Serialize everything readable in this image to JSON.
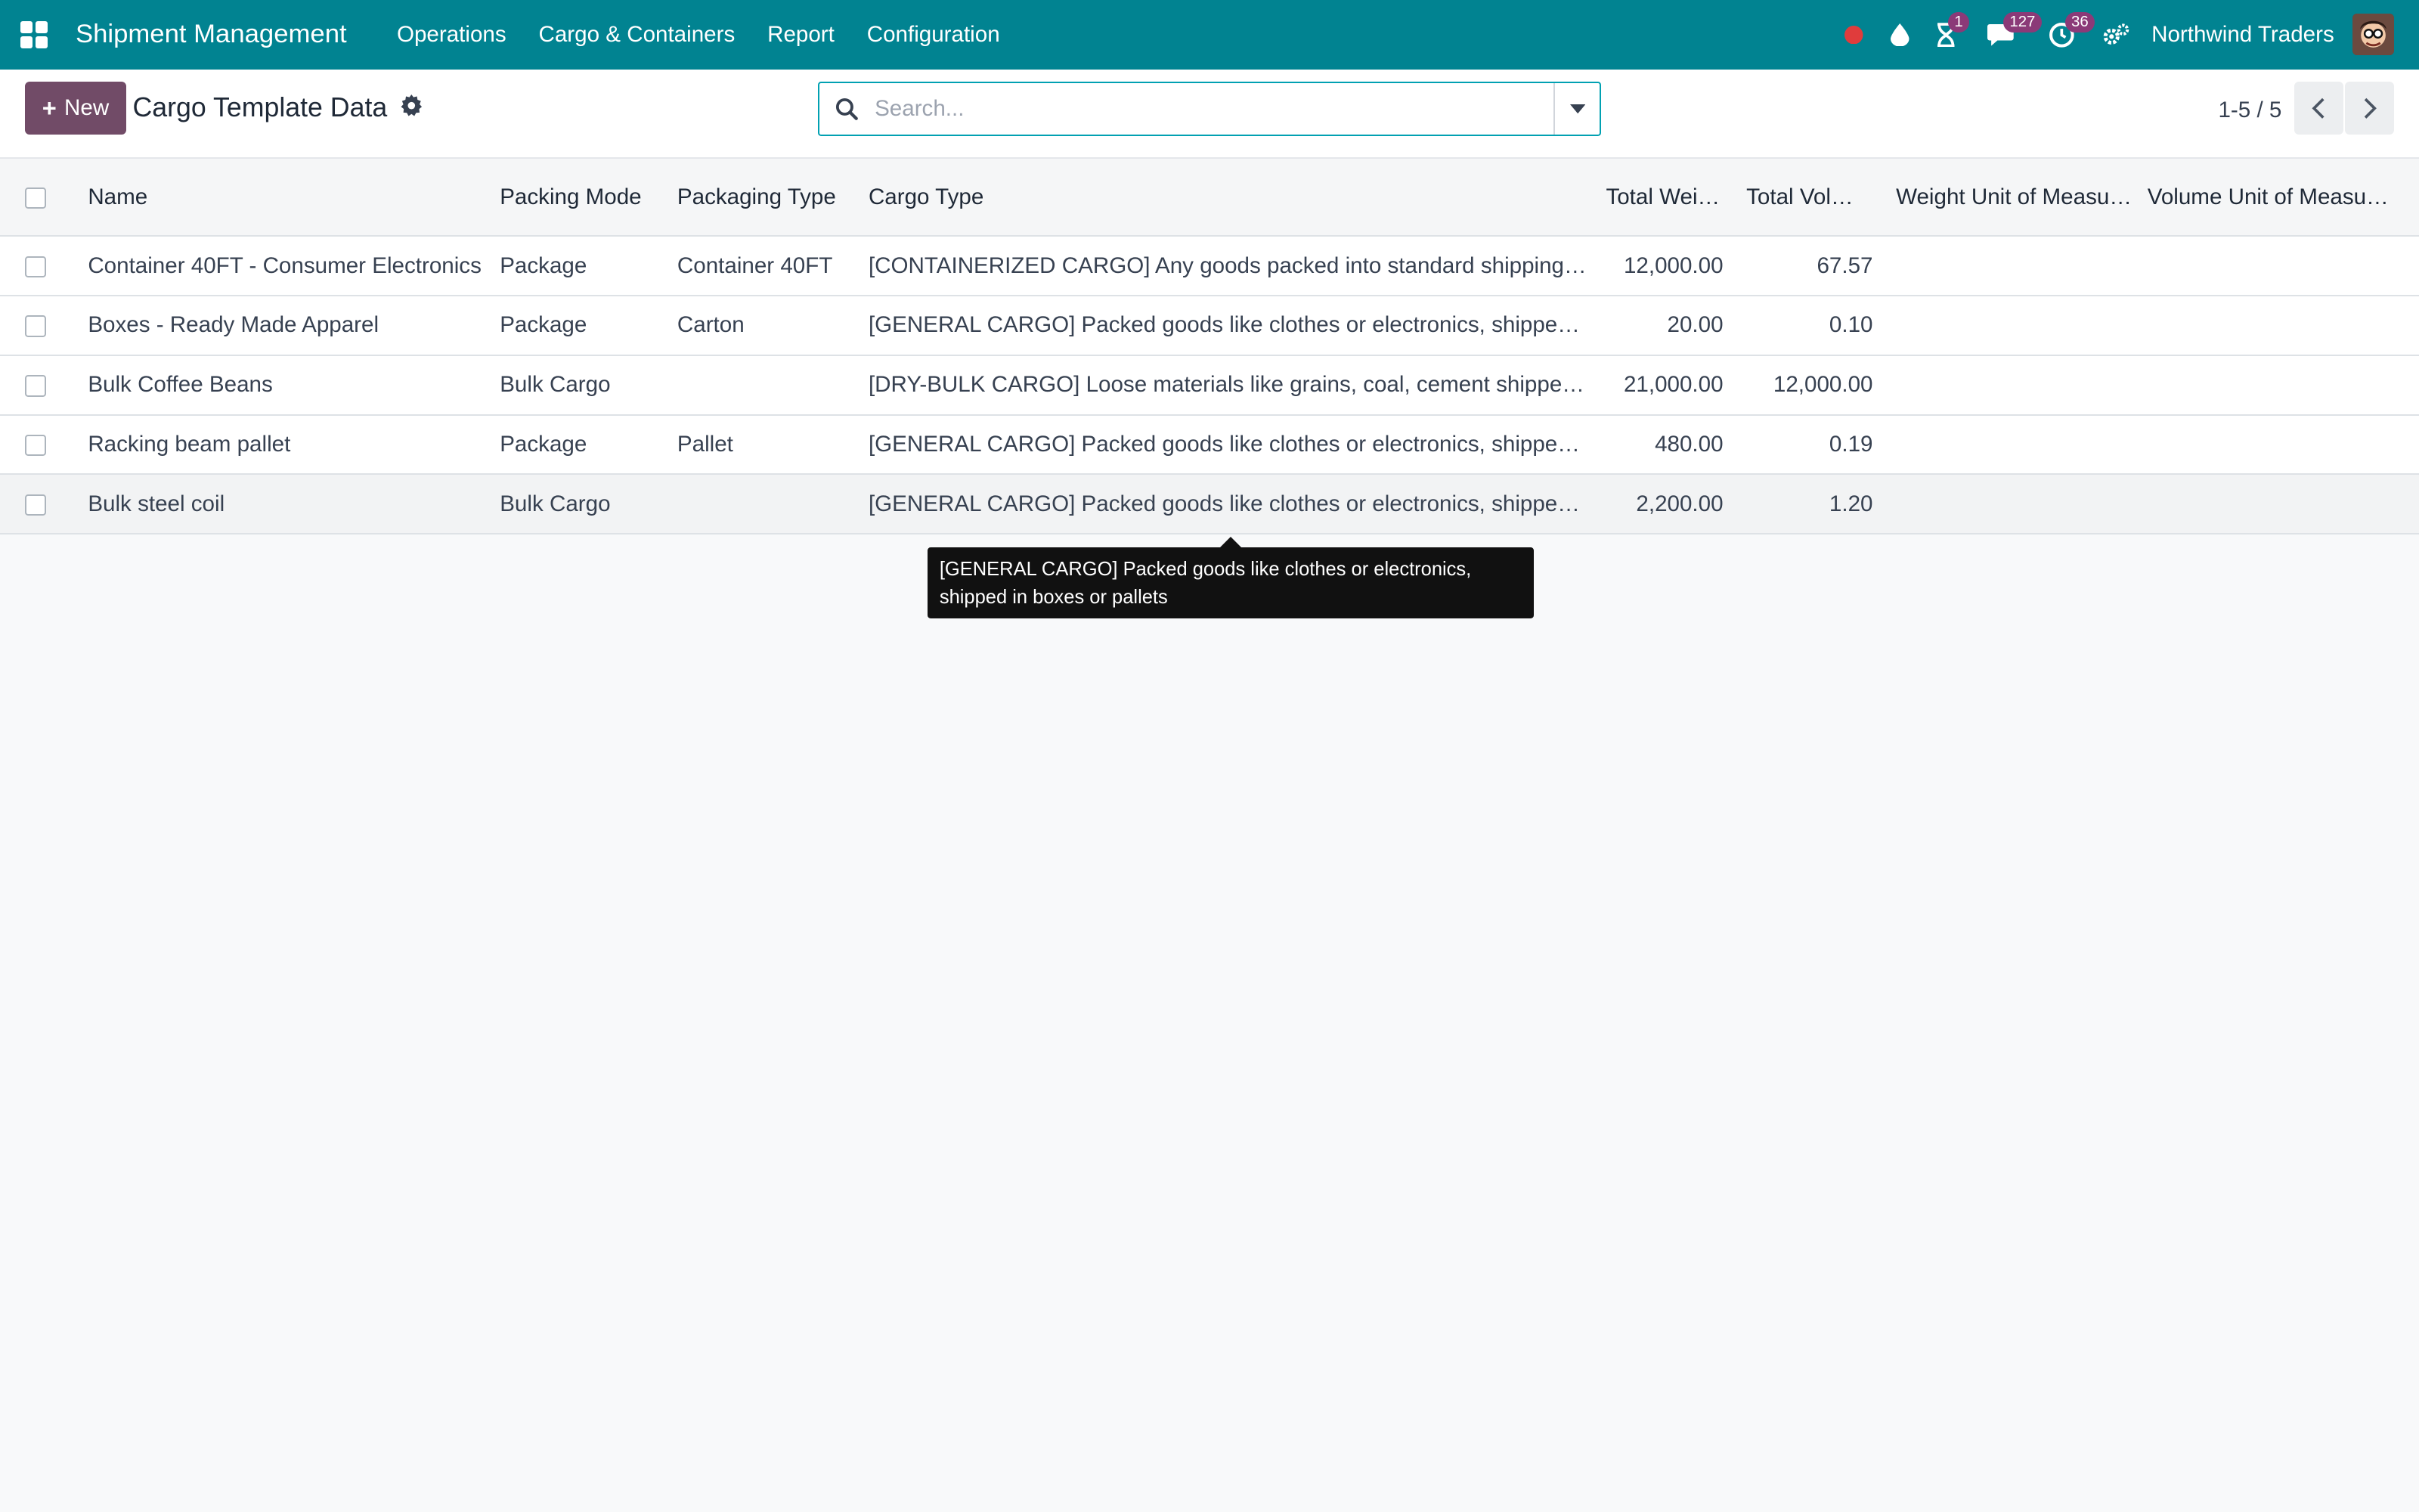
{
  "navbar": {
    "brand": "Shipment Management",
    "menu": [
      "Operations",
      "Cargo & Containers",
      "Report",
      "Configuration"
    ],
    "badges": {
      "activities": "1",
      "messages": "127",
      "timer": "36"
    },
    "company": "Northwind Traders"
  },
  "control": {
    "new_label": "New",
    "title": "Cargo Template Data",
    "search_placeholder": "Search...",
    "pager": "1-5 / 5"
  },
  "table": {
    "columns": [
      "Name",
      "Packing Mode",
      "Packaging Type",
      "Cargo Type",
      "Total Weig…",
      "Total Volu…",
      "Weight Unit of Measu…",
      "Volume Unit of Measu…"
    ],
    "rows": [
      {
        "name": "Container 40FT - Consumer Electronics",
        "packing_mode": "Package",
        "packaging_type": "Container 40FT",
        "cargo_type": "[CONTAINERIZED CARGO] Any goods packed into standard shipping c…",
        "total_weight": "12,000.00",
        "total_volume": "67.57",
        "weight_uom": "",
        "volume_uom": ""
      },
      {
        "name": "Boxes - Ready Made Apparel",
        "packing_mode": "Package",
        "packaging_type": "Carton",
        "cargo_type": "[GENERAL CARGO] Packed goods like clothes or electronics, shipped…",
        "total_weight": "20.00",
        "total_volume": "0.10",
        "weight_uom": "",
        "volume_uom": ""
      },
      {
        "name": "Bulk Coffee Beans",
        "packing_mode": "Bulk Cargo",
        "packaging_type": "",
        "cargo_type": "[DRY-BULK CARGO] Loose materials like grains, coal, cement shipped…",
        "total_weight": "21,000.00",
        "total_volume": "12,000.00",
        "weight_uom": "",
        "volume_uom": ""
      },
      {
        "name": "Racking beam pallet",
        "packing_mode": "Package",
        "packaging_type": "Pallet",
        "cargo_type": "[GENERAL CARGO] Packed goods like clothes or electronics, shipped…",
        "total_weight": "480.00",
        "total_volume": "0.19",
        "weight_uom": "",
        "volume_uom": ""
      },
      {
        "name": "Bulk steel coil",
        "packing_mode": "Bulk Cargo",
        "packaging_type": "",
        "cargo_type": "[GENERAL CARGO] Packed goods like clothes or electronics, shipped…",
        "total_weight": "2,200.00",
        "total_volume": "1.20",
        "weight_uom": "",
        "volume_uom": ""
      }
    ]
  },
  "tooltip": {
    "line1": "[GENERAL CARGO] Packed goods like clothes or electronics,",
    "line2": "shipped in boxes or pallets"
  },
  "colors": {
    "navbar": "#018391",
    "primary": "#714b67",
    "badge": "#8b3a78",
    "record_dot": "#e03c3c"
  }
}
